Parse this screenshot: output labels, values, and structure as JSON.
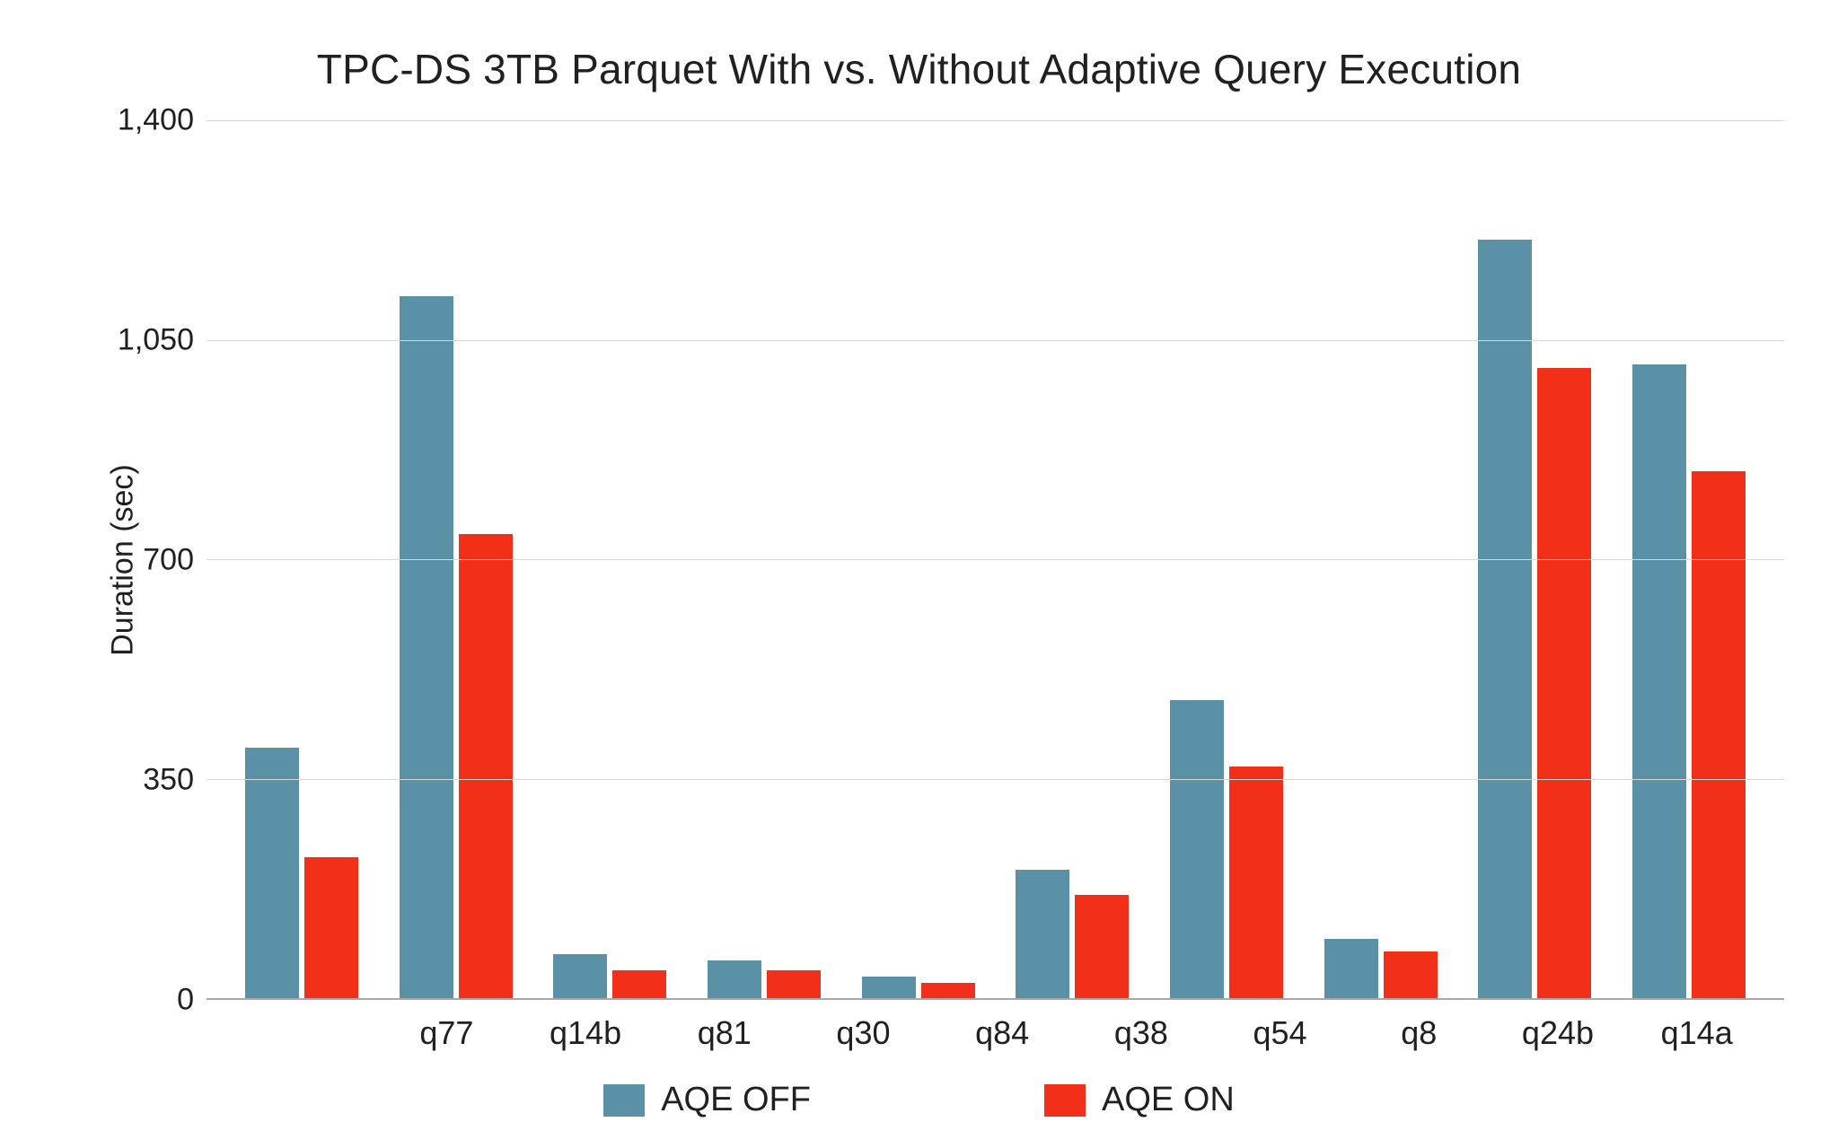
{
  "chart_data": {
    "type": "bar",
    "title": "TPC-DS 3TB Parquet With vs. Without Adaptive Query Execution",
    "ylabel": "Duration (sec)",
    "xlabel": "",
    "ylim": [
      0,
      1400
    ],
    "yticks": [
      0,
      350,
      700,
      1050,
      1400
    ],
    "ytick_labels": [
      "0",
      "350",
      "700",
      "1,050",
      "1,400"
    ],
    "categories": [
      "q77",
      "q14b",
      "q81",
      "q30",
      "q84",
      "q38",
      "q54",
      "q8",
      "q24b",
      "q14a"
    ],
    "series": [
      {
        "name": "AQE OFF",
        "color": "#5b91a6",
        "values": [
          400,
          1120,
          70,
          60,
          35,
          205,
          475,
          95,
          1210,
          1010
        ]
      },
      {
        "name": "AQE ON",
        "color": "#f2301a",
        "values": [
          225,
          740,
          45,
          45,
          25,
          165,
          370,
          75,
          1005,
          840
        ]
      }
    ],
    "legend_position": "bottom"
  }
}
